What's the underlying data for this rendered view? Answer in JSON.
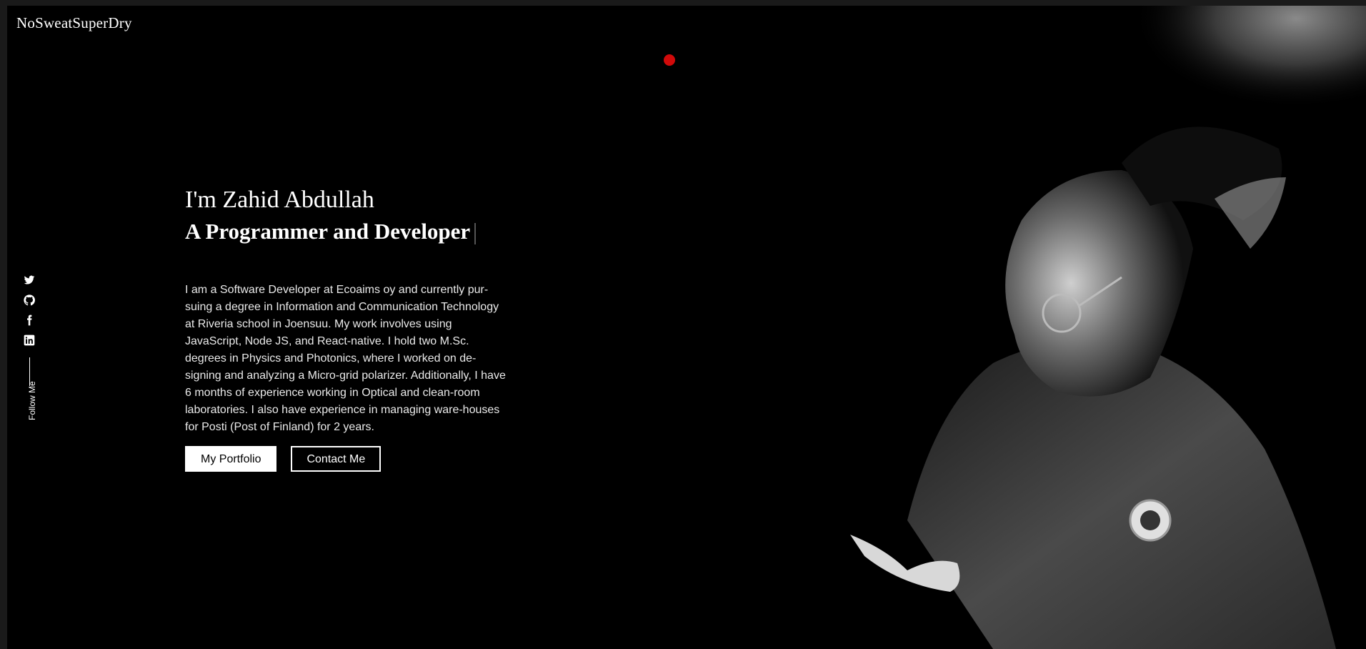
{
  "header": {
    "logo": "NoSweatSuperDry",
    "menu_icon": "hamburger-menu-icon"
  },
  "social": {
    "icons": [
      "twitter-icon",
      "github-icon",
      "facebook-icon",
      "linkedin-icon"
    ],
    "follow_label": "Follow Me"
  },
  "hero": {
    "name": "I'm Zahid Abdullah",
    "role": "A Programmer and Developer",
    "bio": "I am a Software Developer at Ecoaims oy and currently pur-suing a degree in Information and Communication Technology at Riveria school in Joensuu. My work involves using JavaScript, Node JS, and React-native. I hold two M.Sc. degrees in Physics and Photonics, where I worked on de-signing and analyzing a Micro-grid polarizer. Additionally, I have 6 months of experience working in Optical and clean-room laboratories. I also have experience in managing ware-houses for Posti (Post of Finland) for 2 years.",
    "portfolio_label": "My Portfolio",
    "contact_label": "Contact Me"
  },
  "colors": {
    "background": "#000000",
    "accent_dot": "#d10a0a",
    "text": "#ffffff"
  }
}
